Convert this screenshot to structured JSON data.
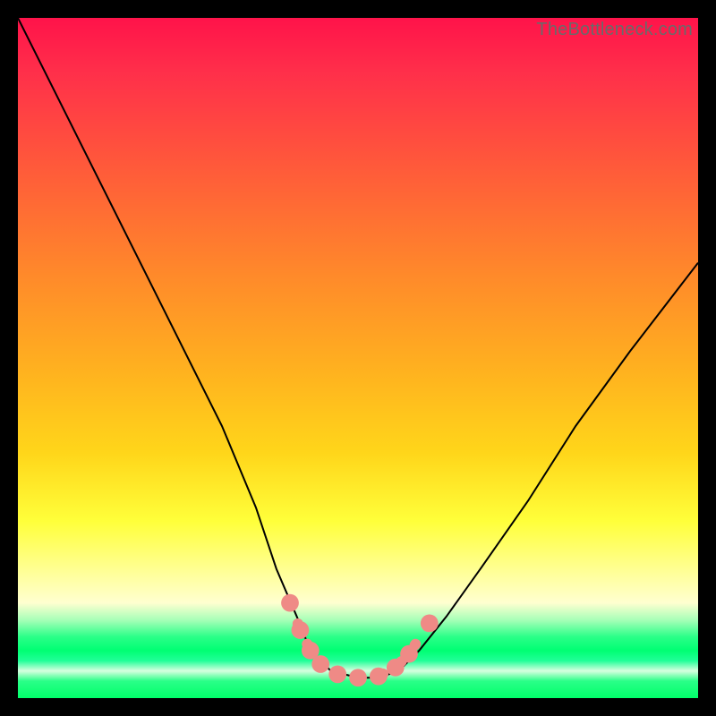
{
  "watermark": "TheBottleneck.com",
  "chart_data": {
    "type": "line",
    "title": "",
    "xlabel": "",
    "ylabel": "",
    "xlim": [
      0,
      100
    ],
    "ylim": [
      0,
      100
    ],
    "series": [
      {
        "name": "curve",
        "x": [
          0,
          6,
          12,
          18,
          24,
          30,
          35,
          38,
          41,
          43,
          46,
          50,
          53,
          56,
          59,
          63,
          68,
          75,
          82,
          90,
          100
        ],
        "y": [
          100,
          88,
          76,
          64,
          52,
          40,
          28,
          19,
          12,
          7,
          4,
          3,
          3,
          4,
          7,
          12,
          19,
          29,
          40,
          51,
          64
        ]
      }
    ],
    "markers": {
      "color": "#ef8a86",
      "points": [
        {
          "x": 40,
          "y": 14
        },
        {
          "x": 41.5,
          "y": 10
        },
        {
          "x": 43,
          "y": 7
        },
        {
          "x": 44.5,
          "y": 5
        },
        {
          "x": 47,
          "y": 3.5
        },
        {
          "x": 50,
          "y": 3
        },
        {
          "x": 53,
          "y": 3.2
        },
        {
          "x": 55.5,
          "y": 4.5
        },
        {
          "x": 57.5,
          "y": 6.5
        },
        {
          "x": 60.5,
          "y": 11
        }
      ]
    },
    "background_gradient": {
      "top": "#ff134a",
      "mid1": "#ff8a2a",
      "mid2": "#ffff3a",
      "green_band": "#00ff73"
    }
  }
}
